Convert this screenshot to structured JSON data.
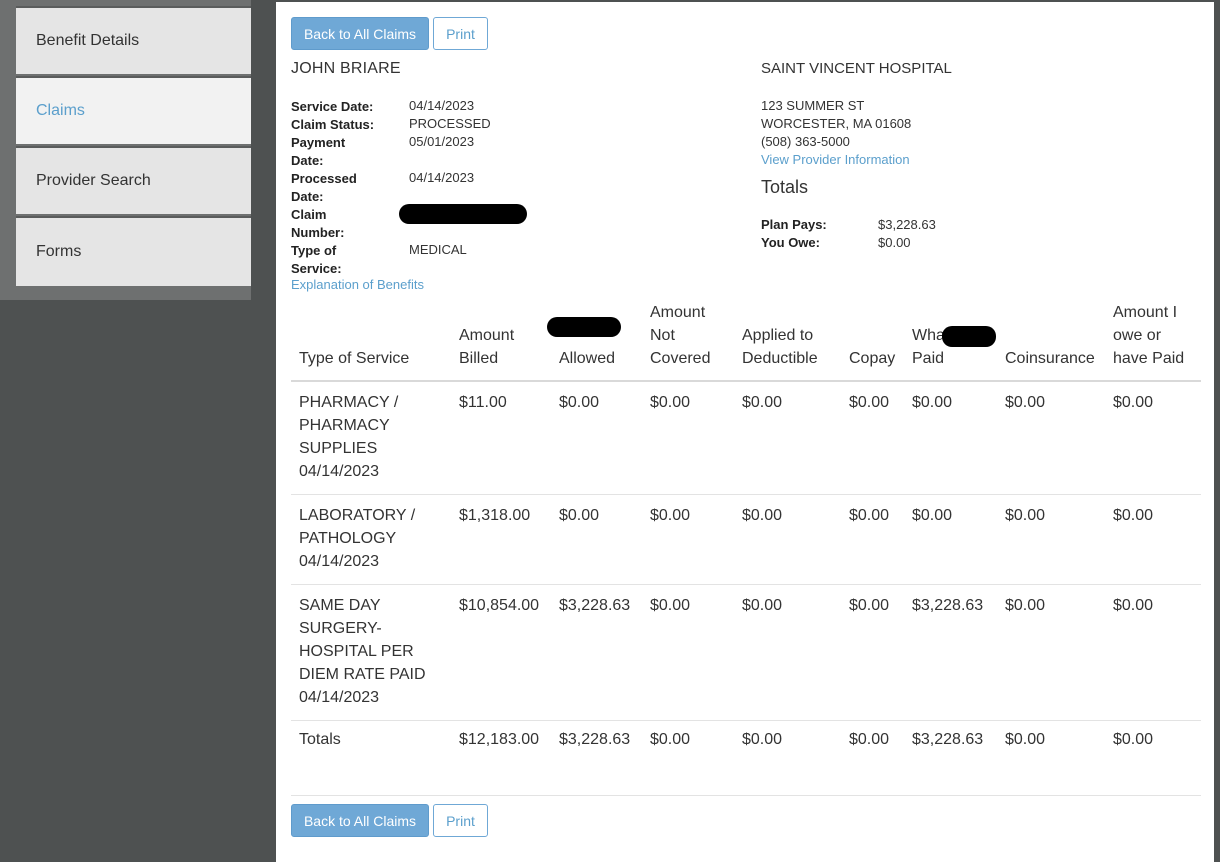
{
  "sidebar": {
    "items": [
      {
        "label": "Benefit Details"
      },
      {
        "label": "Claims"
      },
      {
        "label": "Provider Search"
      },
      {
        "label": "Forms"
      }
    ]
  },
  "toolbar": {
    "back_label": "Back to All Claims",
    "print_label": "Print"
  },
  "claim": {
    "member_name": "JOHN BRIARE",
    "labels": {
      "service_date": "Service Date:",
      "claim_status": "Claim Status:",
      "payment_date": "Payment Date:",
      "processed_date": "Processed Date:",
      "claim_number": "Claim Number:",
      "type_of_service": "Type of Service:"
    },
    "service_date": "04/14/2023",
    "claim_status": "PROCESSED",
    "payment_date": "05/01/2023",
    "processed_date": "04/14/2023",
    "type_of_service": "MEDICAL",
    "eob_link": "Explanation of Benefits"
  },
  "provider": {
    "name": "SAINT VINCENT HOSPITAL",
    "address1": "123 SUMMER ST",
    "address2": "WORCESTER, MA 01608",
    "phone": "(508) 363-5000",
    "info_link": "View Provider Information"
  },
  "totals": {
    "heading": "Totals",
    "plan_pays_label": "Plan Pays:",
    "plan_pays": "$3,228.63",
    "you_owe_label": "You Owe:",
    "you_owe": "$0.00"
  },
  "table": {
    "headers": [
      "Type of Service",
      "Amount Billed",
      "Allowed",
      "Amount Not Covered",
      "Applied to Deductible",
      "Copay",
      "What Paid",
      "Coinsurance",
      "Amount I owe or have Paid"
    ],
    "rows": [
      {
        "service": "PHARMACY / PHARMACY SUPPLIES",
        "date": "04/14/2023",
        "billed": "$11.00",
        "allowed": "$0.00",
        "not_covered": "$0.00",
        "deductible": "$0.00",
        "copay": "$0.00",
        "paid": "$0.00",
        "coinsurance": "$0.00",
        "owe": "$0.00"
      },
      {
        "service": "LABORATORY / PATHOLOGY",
        "date": "04/14/2023",
        "billed": "$1,318.00",
        "allowed": "$0.00",
        "not_covered": "$0.00",
        "deductible": "$0.00",
        "copay": "$0.00",
        "paid": "$0.00",
        "coinsurance": "$0.00",
        "owe": "$0.00"
      },
      {
        "service": "SAME DAY SURGERY-HOSPITAL PER DIEM RATE PAID",
        "date": "04/14/2023",
        "billed": "$10,854.00",
        "allowed": "$3,228.63",
        "not_covered": "$0.00",
        "deductible": "$0.00",
        "copay": "$0.00",
        "paid": "$3,228.63",
        "coinsurance": "$0.00",
        "owe": "$0.00"
      }
    ],
    "totals_row": {
      "label": "Totals",
      "billed": "$12,183.00",
      "allowed": "$3,228.63",
      "not_covered": "$0.00",
      "deductible": "$0.00",
      "copay": "$0.00",
      "paid": "$3,228.63",
      "coinsurance": "$0.00",
      "owe": "$0.00"
    }
  }
}
